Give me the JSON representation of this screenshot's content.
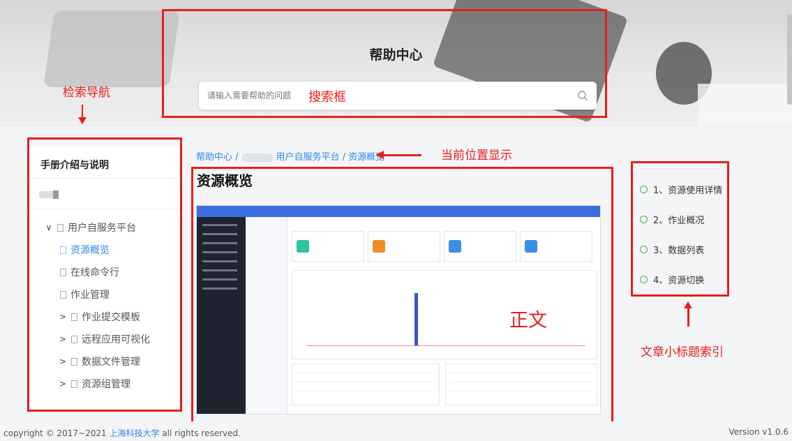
{
  "header": {
    "title": "帮助中心"
  },
  "search": {
    "placeholder": "请输入需要帮助的问题"
  },
  "sidebar": {
    "heading": "手册介绍与说明",
    "tree": [
      {
        "label": "用户自服务平台",
        "toggle": "∨",
        "active": false,
        "indent": 0
      },
      {
        "label": "资源概览",
        "toggle": "",
        "active": true,
        "indent": 1
      },
      {
        "label": "在线命令行",
        "toggle": "",
        "active": false,
        "indent": 1
      },
      {
        "label": "作业管理",
        "toggle": "",
        "active": false,
        "indent": 1
      },
      {
        "label": "作业提交模板",
        "toggle": ">",
        "active": false,
        "indent": 1
      },
      {
        "label": "远程应用可视化",
        "toggle": ">",
        "active": false,
        "indent": 1
      },
      {
        "label": "数据文件管理",
        "toggle": ">",
        "active": false,
        "indent": 1
      },
      {
        "label": "资源组管理",
        "toggle": ">",
        "active": false,
        "indent": 1
      }
    ]
  },
  "breadcrumb": {
    "root": "帮助中心 /",
    "rest": "用户自服务平台 / 资源概览"
  },
  "article": {
    "title": "资源概览"
  },
  "toc": [
    {
      "label": "1、资源使用详情"
    },
    {
      "label": "2、作业概况"
    },
    {
      "label": "3、数据列表"
    },
    {
      "label": "4、资源切换"
    }
  ],
  "footer": {
    "copyright_prefix": "copyright © 2017~2021",
    "org": "上海科技大学",
    "copyright_suffix": "all rights reserved.",
    "version": "Version v1.0.6"
  },
  "annotations": {
    "nav": "检索导航",
    "search_box": "搜索框",
    "location": "当前位置显示",
    "body": "正文",
    "toc_index": "文章小标题索引"
  },
  "colors": {
    "annotation": "#ec1c1c",
    "link": "#2a8ae6",
    "toc_dot": "#4caf50"
  }
}
